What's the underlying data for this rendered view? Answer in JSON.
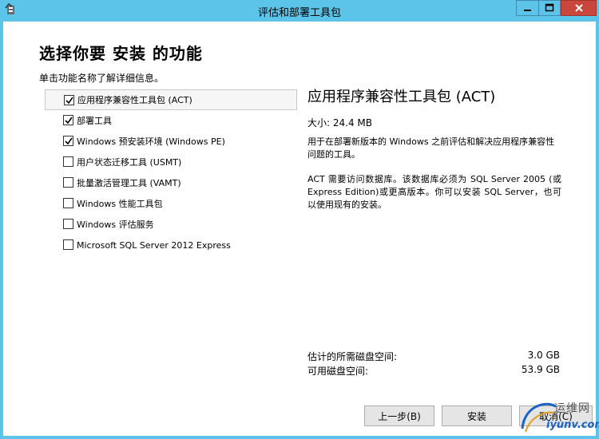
{
  "window": {
    "title": "评估和部署工具包",
    "accent": "#5cc4e8",
    "close_color": "#c9463d"
  },
  "page": {
    "heading": "选择你要 安装 的功能",
    "subheading": "单击功能名称了解详细信息。"
  },
  "features": [
    {
      "label": "应用程序兼容性工具包 (ACT)",
      "checked": true,
      "selected": true
    },
    {
      "label": "部署工具",
      "checked": true,
      "selected": false
    },
    {
      "label": "Windows 预安装环境 (Windows PE)",
      "checked": true,
      "selected": false
    },
    {
      "label": "用户状态迁移工具 (USMT)",
      "checked": false,
      "selected": false
    },
    {
      "label": "批量激活管理工具 (VAMT)",
      "checked": false,
      "selected": false
    },
    {
      "label": "Windows 性能工具包",
      "checked": false,
      "selected": false
    },
    {
      "label": "Windows 评估服务",
      "checked": false,
      "selected": false
    },
    {
      "label": "Microsoft SQL Server 2012 Express",
      "checked": false,
      "selected": false
    }
  ],
  "detail": {
    "title": "应用程序兼容性工具包 (ACT)",
    "size": "大小: 24.4 MB",
    "description": "用于在部署新版本的 Windows 之前评估和解决应用程序兼容性问题的工具。",
    "requirement": "ACT 需要访问数据库。该数据库必须为 SQL Server 2005 (或 Express Edition)或更高版本。你可以安装 SQL Server，也可以使用现有的安装。"
  },
  "disk": {
    "required_label": "估计的所需磁盘空间:",
    "required_value": "3.0 GB",
    "available_label": "可用磁盘空间:",
    "available_value": "53.9 GB"
  },
  "buttons": {
    "back": "上一步(B)",
    "install": "安装",
    "cancel": "取消(C)"
  },
  "watermark": {
    "brand": "运维网",
    "url": "iyunv.com"
  }
}
